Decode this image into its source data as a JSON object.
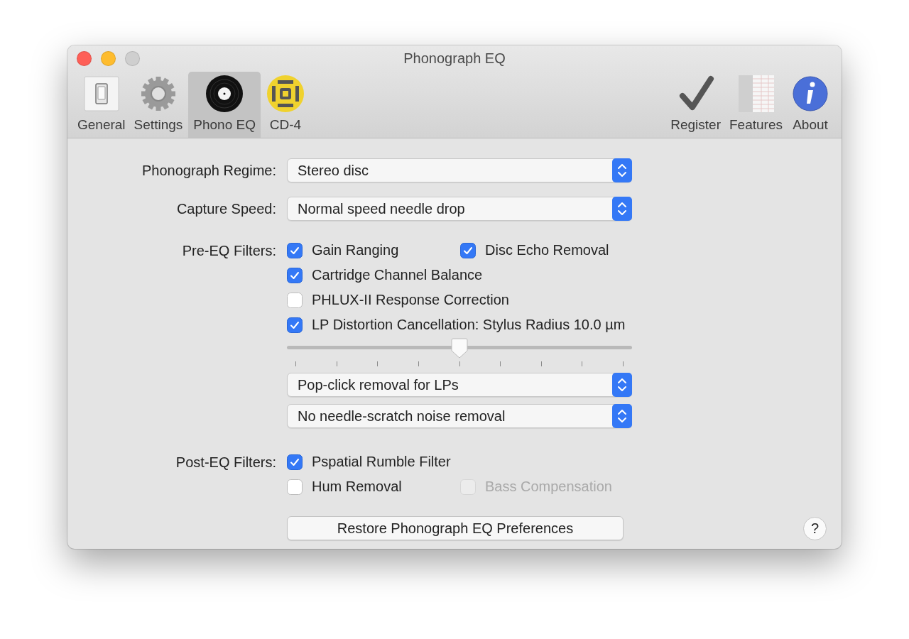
{
  "window": {
    "title": "Phonograph EQ"
  },
  "toolbar": {
    "left_items": [
      {
        "label": "General",
        "selected": false
      },
      {
        "label": "Settings",
        "selected": false
      },
      {
        "label": "Phono EQ",
        "selected": true
      },
      {
        "label": "CD-4",
        "selected": false
      }
    ],
    "right_items": [
      {
        "label": "Register",
        "selected": false
      },
      {
        "label": "Features",
        "selected": false
      },
      {
        "label": "About",
        "selected": false
      }
    ]
  },
  "form": {
    "regime": {
      "label": "Phonograph Regime:",
      "value": "Stereo disc"
    },
    "speed": {
      "label": "Capture Speed:",
      "value": "Normal speed needle drop"
    },
    "pre_eq": {
      "label": "Pre-EQ Filters:",
      "rows": [
        [
          {
            "label": "Gain Ranging",
            "checked": true,
            "disabled": false
          },
          {
            "label": "Disc Echo Removal",
            "checked": true,
            "disabled": false
          }
        ],
        [
          {
            "label": "Cartridge Channel Balance",
            "checked": true,
            "disabled": false
          }
        ],
        [
          {
            "label": "PHLUX-II Response Correction",
            "checked": false,
            "disabled": false
          }
        ],
        [
          {
            "label": "LP Distortion Cancellation: Stylus Radius 10.0 µm",
            "checked": true,
            "disabled": false
          }
        ]
      ]
    },
    "stylus_slider": {
      "level": 0.5
    },
    "popclick": {
      "value": "Pop-click removal for LPs"
    },
    "scratch": {
      "value": "No needle-scratch noise removal"
    },
    "post_eq": {
      "label": "Post-EQ Filters:",
      "rows": [
        [
          {
            "label": "Pspatial Rumble Filter",
            "checked": true,
            "disabled": false
          }
        ],
        [
          {
            "label": "Hum Removal",
            "checked": false,
            "disabled": false
          },
          {
            "label": "Bass Compensation",
            "checked": false,
            "disabled": true
          }
        ]
      ]
    },
    "restore_button": "Restore Phonograph EQ Preferences",
    "help_button": "?"
  }
}
